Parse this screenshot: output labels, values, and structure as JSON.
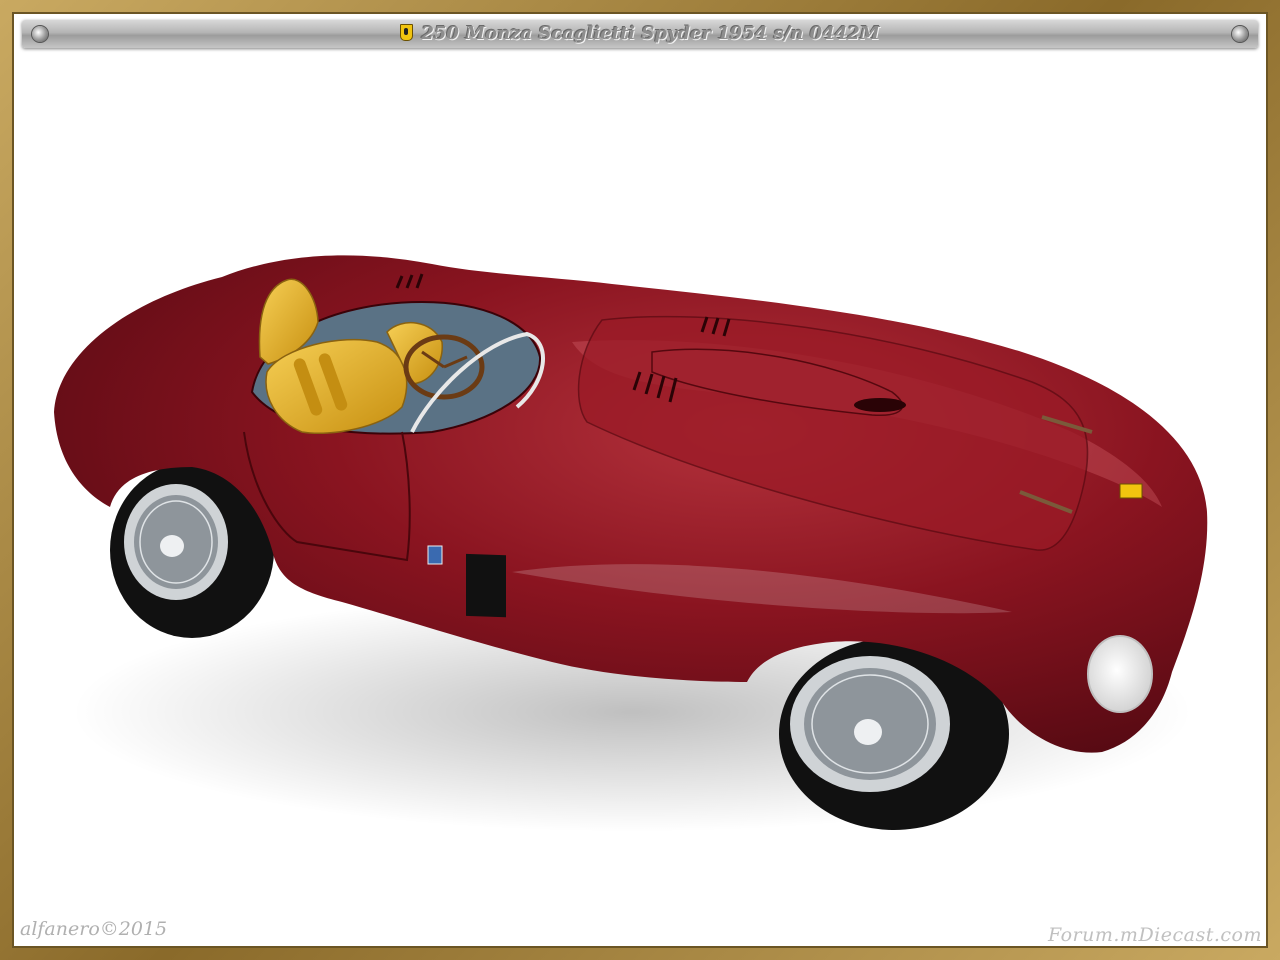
{
  "title": "250 Monza Scaglietti Spyder 1954  s/n 0442M",
  "watermark": "alfanero©2015",
  "site_logo": "Forum.mDiecast.com",
  "colors": {
    "body": "#7a0f18",
    "seat": "#e8b22a",
    "frame": "#b89a5a"
  },
  "icons": [
    "ferrari-badge-icon",
    "screw-icon"
  ]
}
